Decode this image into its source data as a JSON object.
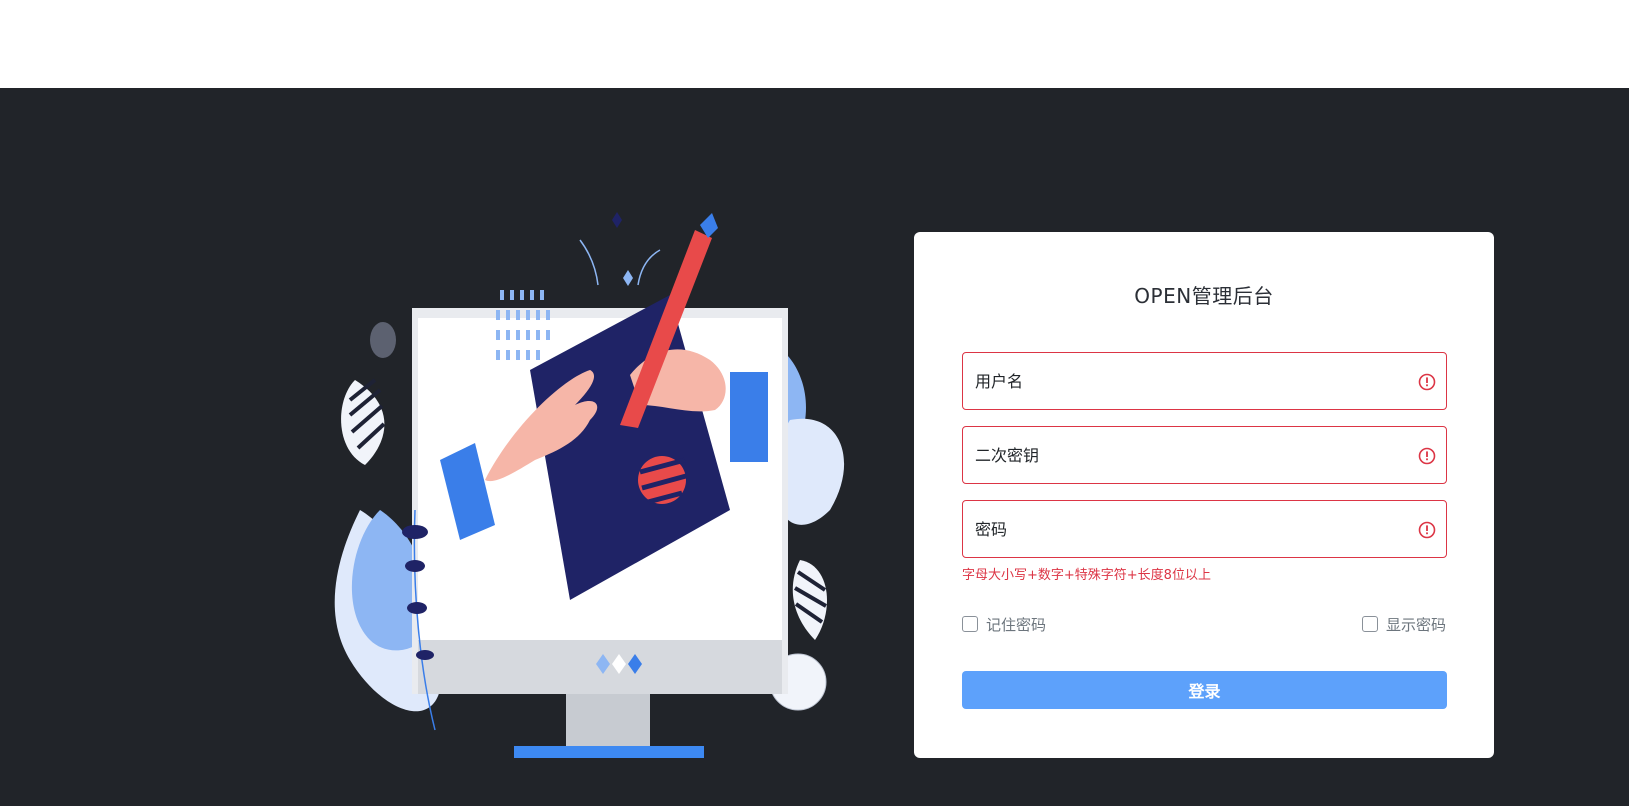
{
  "login": {
    "title": "OPEN管理后台",
    "username_placeholder": "用户名",
    "secret_placeholder": "二次密钥",
    "password_placeholder": "密码",
    "password_hint": "字母大小写+数字+特殊字符+长度8位以上",
    "remember_label": "记住密码",
    "show_password_label": "显示密码",
    "submit_label": "登录"
  },
  "colors": {
    "background_dark": "#212429",
    "accent_button": "#5da1fb",
    "error": "#dc3545"
  },
  "icons": {
    "field_status": "exclamation-circle-icon"
  }
}
